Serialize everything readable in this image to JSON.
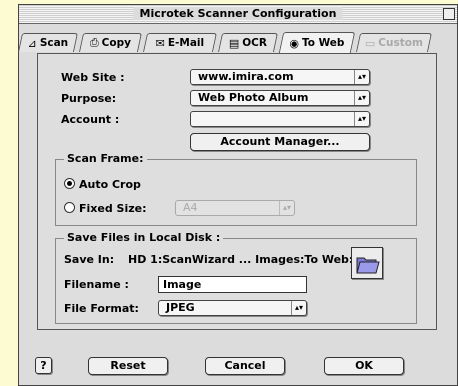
{
  "window": {
    "title": "Microtek Scanner Configuration"
  },
  "tabs": [
    {
      "label": "Scan",
      "icon": "scanner-icon",
      "glyph": "⊿"
    },
    {
      "label": "Copy",
      "icon": "printer-icon",
      "glyph": "⎙"
    },
    {
      "label": "E-Mail",
      "icon": "email-icon",
      "glyph": "✉"
    },
    {
      "label": "OCR",
      "icon": "ocr-icon",
      "glyph": "▤"
    },
    {
      "label": "To Web",
      "icon": "globe-icon",
      "glyph": "◉",
      "active": true
    },
    {
      "label": "Custom",
      "icon": "folder-icon",
      "glyph": "▭",
      "disabled": true
    }
  ],
  "form": {
    "website_label": "Web Site :",
    "website_value": "www.imira.com",
    "purpose_label": "Purpose:",
    "purpose_value": "Web Photo Album",
    "account_label": "Account :",
    "account_value": "",
    "account_manager_button": "Account Manager..."
  },
  "scan_frame": {
    "title": "Scan Frame:",
    "auto_crop_label": "Auto Crop",
    "fixed_size_label": "Fixed Size:",
    "fixed_size_value": "A4",
    "selected": "auto_crop"
  },
  "save_files": {
    "title": "Save Files in Local Disk :",
    "save_in_label": "Save In:",
    "save_in_path": "HD 1:ScanWizard ... Images:To Web:",
    "filename_label": "Filename :",
    "filename_value": "Image",
    "format_label": "File Format:",
    "format_value": "JPEG"
  },
  "bottom": {
    "help_glyph": "?",
    "reset_label": "Reset",
    "cancel_label": "Cancel",
    "ok_label": "OK"
  },
  "colors": {
    "background": "#fdfbd2",
    "window": "#dcdcdc",
    "panel": "#dedede",
    "folder": "#7d7bd6"
  }
}
